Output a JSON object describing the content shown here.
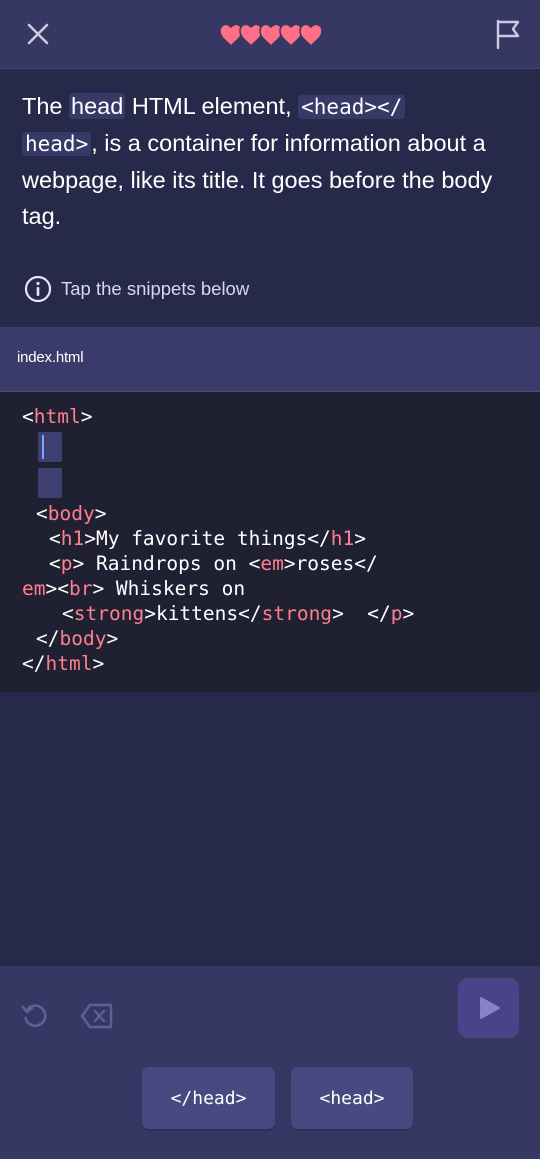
{
  "lives": {
    "count": 5,
    "color": "#ff6f86"
  },
  "lesson": {
    "p1": "The ",
    "term": "head",
    "p2": " HTML element, ",
    "code_a": "<head></",
    "code_b": "head>",
    "p3": ", is a container for information about a webpage, like its title. It goes before the body tag."
  },
  "hint": {
    "icon": "info-icon",
    "text": "Tap the snippets below"
  },
  "file": {
    "name": "index.html"
  },
  "code": {
    "l1a": "<",
    "l1b": "html",
    "l1c": ">",
    "l4a": "<",
    "l4b": "body",
    "l4c": ">",
    "l5a": "<",
    "l5b": "h1",
    "l5c": ">My favorite things</",
    "l5d": "h1",
    "l5e": ">",
    "l6a": "<",
    "l6b": "p",
    "l6c": "> Raindrops on <",
    "l6d": "em",
    "l6e": ">roses</",
    "l7a": "em",
    "l7b": "><",
    "l7c": "br",
    "l7d": "> Whiskers on",
    "l8a": "<",
    "l8b": "strong",
    "l8c": ">kittens</",
    "l8d": "strong",
    "l8e": ">  </",
    "l8f": "p",
    "l8g": ">",
    "l9a": "</",
    "l9b": "body",
    "l9c": ">",
    "l10a": "</",
    "l10b": "html",
    "l10c": ">"
  },
  "snippets": [
    "</head>",
    "<head>"
  ],
  "controls": {
    "undo": "undo-icon",
    "delete": "backspace-icon",
    "run": "play-icon"
  }
}
